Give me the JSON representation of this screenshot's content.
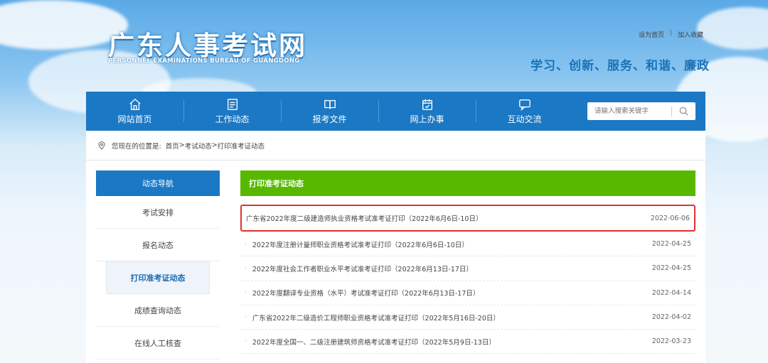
{
  "header": {
    "title": "广东人事考试网",
    "subtitle": "PERSONNEL EXAMINATIONS BUREAU OF GUANGDONG",
    "slogan": "学习、创新、服务、和谐、廉政",
    "links": {
      "homepage": "设为首页",
      "separator": "|",
      "favorite": "加入收藏"
    }
  },
  "nav": {
    "items": [
      {
        "label": "网站首页",
        "icon": "home-icon"
      },
      {
        "label": "工作动态",
        "icon": "list-icon"
      },
      {
        "label": "报考文件",
        "icon": "book-icon"
      },
      {
        "label": "网上办事",
        "icon": "calendar-check-icon"
      },
      {
        "label": "互动交流",
        "icon": "chat-icon"
      }
    ],
    "search": {
      "placeholder": "请输入搜索关键字",
      "icon": "search-icon"
    }
  },
  "breadcrumb": {
    "prefix": "您现在的位置是:",
    "path": [
      "首页",
      "考试动态",
      "打印准考证动态"
    ],
    "separator": ">",
    "icon": "location-icon"
  },
  "sidebar": {
    "title": "动态导航",
    "items": [
      {
        "label": "考试安排"
      },
      {
        "label": "报名动态"
      },
      {
        "label": "打印准考证动态"
      },
      {
        "label": "成绩查询动态"
      },
      {
        "label": "在线人工核查"
      }
    ],
    "active_label": "打印准考证动态"
  },
  "main": {
    "title": "打印准考证动态",
    "news": [
      {
        "title": "广东省2022年度二级建造师执业资格考试准考证打印（2022年6月6日-10日）",
        "date": "2022-06-06"
      },
      {
        "title": "2022年度注册计量师职业资格考试准考证打印（2022年6月6日-10日）",
        "date": "2022-04-25"
      },
      {
        "title": "2022年度社会工作者职业水平考试准考证打印（2022年6月13日-17日）",
        "date": "2022-04-25"
      },
      {
        "title": "2022年度翻译专业资格（水平）考试准考证打印（2022年6月13日-17日）",
        "date": "2022-04-14"
      },
      {
        "title": "广东省2022年二级造价工程师职业资格考试准考证打印（2022年5月16日-20日）",
        "date": "2022-04-02"
      },
      {
        "title": "2022年度全国一、二级注册建筑师资格考试准考证打印（2022年5月9日-13日）",
        "date": "2022-03-23"
      }
    ],
    "highlight_color": "#e03030"
  },
  "colors": {
    "primary_blue": "#1b78c4",
    "green": "#58b800",
    "slogan_blue": "#1a73b8"
  }
}
